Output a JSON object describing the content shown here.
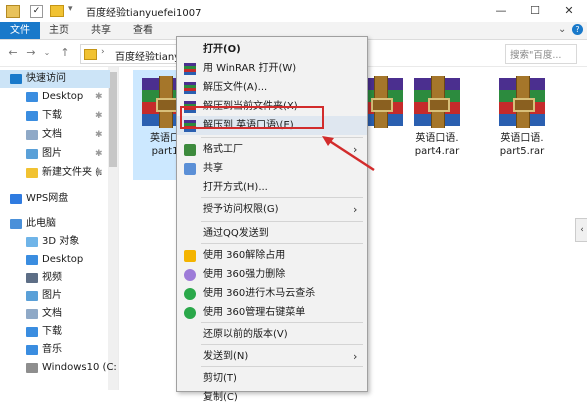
{
  "titlebar": {
    "title": "百度经验tianyuefei1007",
    "buttons": [
      "—",
      "☐",
      "✕"
    ]
  },
  "ribbon": {
    "tabs": [
      "文件",
      "主页",
      "共享",
      "查看"
    ]
  },
  "address": {
    "path": "百度经验tianyu",
    "search_placeholder": "搜索\"百度..."
  },
  "sidebar": {
    "items": [
      {
        "label": "快速访问",
        "pinned": false,
        "icon": "star-icon"
      },
      {
        "label": "Desktop",
        "pinned": true,
        "icon": "desktop-icon"
      },
      {
        "label": "下载",
        "pinned": true,
        "icon": "download-icon"
      },
      {
        "label": "文档",
        "pinned": true,
        "icon": "document-icon"
      },
      {
        "label": "图片",
        "pinned": true,
        "icon": "picture-icon"
      },
      {
        "label": "新建文件夹 (:",
        "pinned": true,
        "icon": "folder-icon"
      },
      {
        "label": "WPS网盘",
        "pinned": false,
        "icon": "cloud-icon"
      },
      {
        "label": "此电脑",
        "pinned": false,
        "icon": "computer-icon"
      },
      {
        "label": "3D 对象",
        "pinned": false,
        "icon": "3d-icon"
      },
      {
        "label": "Desktop",
        "pinned": false,
        "icon": "desktop-icon"
      },
      {
        "label": "视频",
        "pinned": false,
        "icon": "video-icon"
      },
      {
        "label": "图片",
        "pinned": false,
        "icon": "picture-icon"
      },
      {
        "label": "文档",
        "pinned": false,
        "icon": "document-icon"
      },
      {
        "label": "下载",
        "pinned": false,
        "icon": "download-icon"
      },
      {
        "label": "音乐",
        "pinned": false,
        "icon": "music-icon"
      },
      {
        "label": "Windows10 (C:",
        "pinned": false,
        "icon": "drive-icon"
      }
    ]
  },
  "files": [
    {
      "line1": "英语口",
      "line2": "part1",
      "selected": true
    },
    {
      "line1": "",
      "line2": "",
      "selected": false
    },
    {
      "line1": "英语口语.",
      "line2": "part4.rar",
      "selected": false
    },
    {
      "line1": "英语口语.",
      "line2": "part5.rar",
      "selected": false
    }
  ],
  "context_menu": {
    "items": [
      {
        "label": "打开(O)",
        "bold": true,
        "icon": "",
        "submenu": false
      },
      {
        "label": "用 WinRAR 打开(W)",
        "icon": "winrar-icon",
        "submenu": false
      },
      {
        "label": "解压文件(A)...",
        "icon": "winrar-icon",
        "submenu": false
      },
      {
        "label": "解压到当前文件夹(X)",
        "icon": "winrar-icon",
        "submenu": false
      },
      {
        "label": "解压到 英语口语\\(E)",
        "icon": "winrar-icon",
        "submenu": false,
        "highlighted": true
      },
      {
        "label": "格式工厂",
        "icon": "format-factory-icon",
        "submenu": true
      },
      {
        "label": "共享",
        "icon": "share-icon",
        "submenu": false
      },
      {
        "label": "打开方式(H)...",
        "icon": "",
        "submenu": false
      },
      {
        "label": "授予访问权限(G)",
        "icon": "",
        "submenu": true
      },
      {
        "label": "通过QQ发送到",
        "icon": "",
        "submenu": false
      },
      {
        "label": "使用 360解除占用",
        "icon": "360-unlock-icon",
        "submenu": false
      },
      {
        "label": "使用 360强力删除",
        "icon": "360-delete-icon",
        "submenu": false
      },
      {
        "label": "使用 360进行木马云查杀",
        "icon": "360-scan-icon",
        "submenu": false
      },
      {
        "label": "使用 360管理右键菜单",
        "icon": "360-manage-icon",
        "submenu": false
      },
      {
        "label": "还原以前的版本(V)",
        "icon": "",
        "submenu": false
      },
      {
        "label": "发送到(N)",
        "icon": "",
        "submenu": true
      },
      {
        "label": "剪切(T)",
        "icon": "",
        "submenu": false
      },
      {
        "label": "复制(C)",
        "icon": "",
        "submenu": false
      }
    ]
  },
  "colors": {
    "accent": "#1979ca",
    "highlight_box": "#d22c2c",
    "selection": "#cce8ff"
  }
}
